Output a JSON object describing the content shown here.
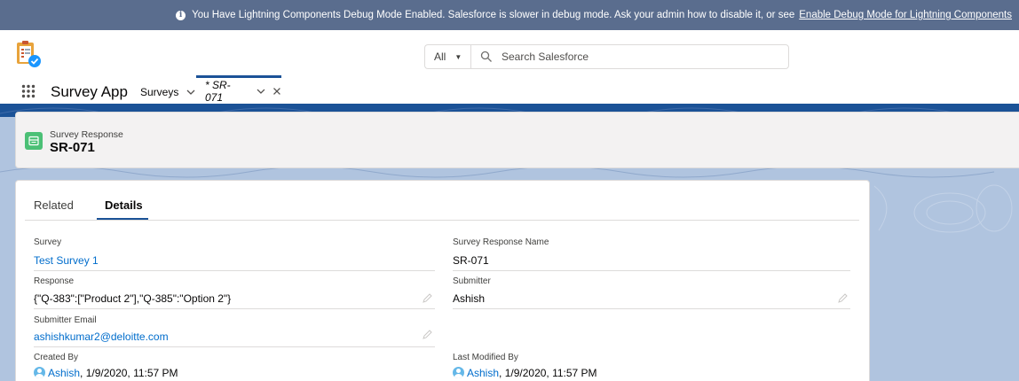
{
  "banner": {
    "message": "You Have Lightning Components Debug Mode Enabled. Salesforce is slower in debug mode. Ask your admin how to disable it, or see",
    "link_text": "Enable Debug Mode for Lightning Components"
  },
  "header": {
    "scope_label": "All",
    "search_placeholder": "Search Salesforce"
  },
  "nav": {
    "app_name": "Survey App",
    "items": [
      {
        "label": "Surveys"
      }
    ],
    "active_tab": {
      "label": "* SR-071"
    }
  },
  "record": {
    "object_label": "Survey Response",
    "title": "SR-071"
  },
  "tabs": [
    {
      "label": "Related",
      "active": false
    },
    {
      "label": "Details",
      "active": true
    }
  ],
  "fields": {
    "survey": {
      "label": "Survey",
      "value": "Test Survey 1"
    },
    "survey_response_name": {
      "label": "Survey Response Name",
      "value": "SR-071"
    },
    "response": {
      "label": "Response",
      "value": "{\"Q-383\":[\"Product 2\"],\"Q-385\":\"Option 2\"}"
    },
    "submitter": {
      "label": "Submitter",
      "value": "Ashish"
    },
    "submitter_email": {
      "label": "Submitter Email",
      "value": "ashishkumar2@deloitte.com"
    },
    "created_by": {
      "label": "Created By",
      "user": "Ashish",
      "date": ", 1/9/2020, 11:57 PM"
    },
    "last_modified_by": {
      "label": "Last Modified By",
      "user": "Ashish",
      "date": ", 1/9/2020, 11:57 PM"
    }
  },
  "colors": {
    "brand": "#1b5297",
    "link": "#006dcc",
    "banner": "#5a6d8e",
    "object_icon": "#4bc076"
  }
}
